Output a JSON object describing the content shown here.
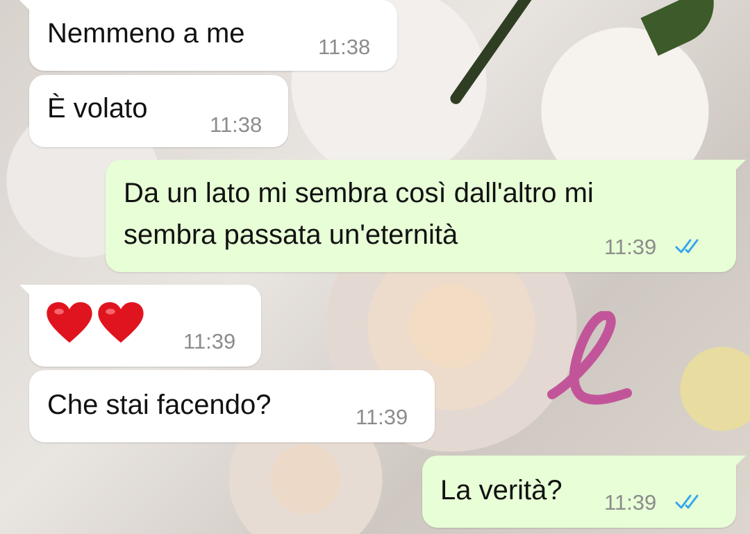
{
  "chat": {
    "messages": [
      {
        "direction": "incoming",
        "text": "Nemmeno a me",
        "time": "11:38"
      },
      {
        "direction": "incoming",
        "text": "È volato",
        "time": "11:38"
      },
      {
        "direction": "outgoing",
        "lines": [
          "Da un lato mi sembra così dall'altro mi",
          "sembra passata un'eternità"
        ],
        "time": "11:39",
        "status_icon": "double-check-read-icon"
      },
      {
        "direction": "incoming",
        "emoji": "red-heart-icon ×2",
        "time": "11:39"
      },
      {
        "direction": "incoming",
        "text": "Che stai facendo?",
        "time": "11:39"
      },
      {
        "direction": "outgoing",
        "text": "La verità?",
        "time": "11:39",
        "status_icon": "double-check-read-icon"
      }
    ]
  },
  "colors": {
    "incoming_bubble": "#ffffff",
    "outgoing_bubble": "#e7fed6",
    "read_check": "#35a6f0",
    "timestamp": "#8c8c8c",
    "scribble": "#c2559a"
  }
}
